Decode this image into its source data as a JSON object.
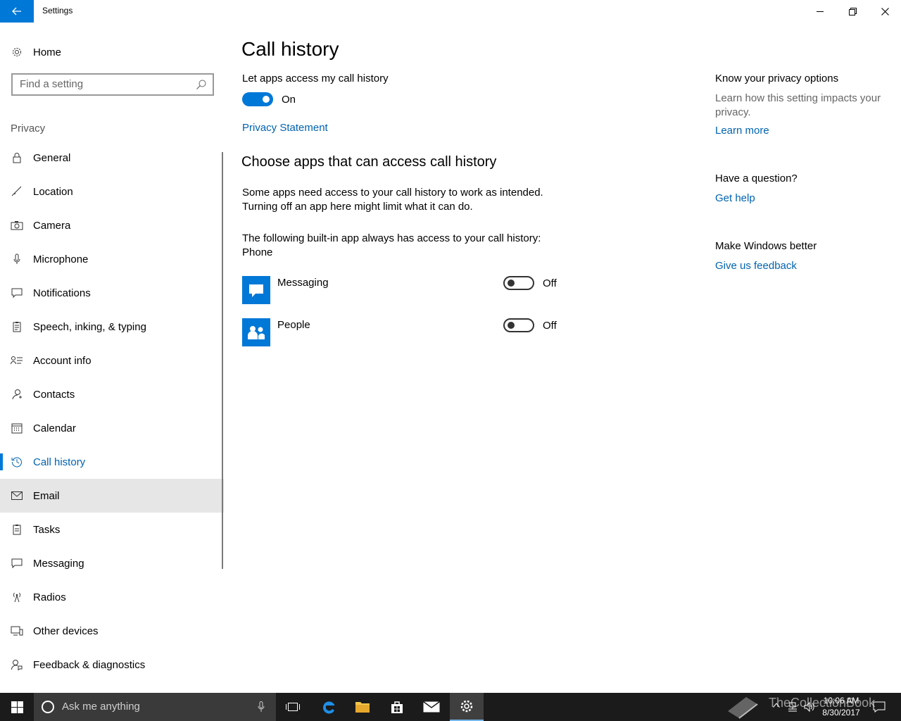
{
  "window": {
    "title": "Settings"
  },
  "sidebar": {
    "home": "Home",
    "search_placeholder": "Find a setting",
    "section": "Privacy",
    "items": [
      {
        "label": "General",
        "icon": "lock-icon"
      },
      {
        "label": "Location",
        "icon": "location-icon"
      },
      {
        "label": "Camera",
        "icon": "camera-icon"
      },
      {
        "label": "Microphone",
        "icon": "microphone-icon"
      },
      {
        "label": "Notifications",
        "icon": "notifications-icon"
      },
      {
        "label": "Speech, inking, & typing",
        "icon": "clipboard-icon"
      },
      {
        "label": "Account info",
        "icon": "account-info-icon"
      },
      {
        "label": "Contacts",
        "icon": "contacts-icon"
      },
      {
        "label": "Calendar",
        "icon": "calendar-icon"
      },
      {
        "label": "Call history",
        "icon": "history-icon"
      },
      {
        "label": "Email",
        "icon": "mail-icon"
      },
      {
        "label": "Tasks",
        "icon": "tasks-icon"
      },
      {
        "label": "Messaging",
        "icon": "message-icon"
      },
      {
        "label": "Radios",
        "icon": "radio-tower-icon"
      },
      {
        "label": "Other devices",
        "icon": "devices-icon"
      },
      {
        "label": "Feedback & diagnostics",
        "icon": "feedback-icon"
      }
    ]
  },
  "main": {
    "title": "Call history",
    "master_label": "Let apps access my call history",
    "master_state": "On",
    "privacy_link": "Privacy Statement",
    "choose_heading": "Choose apps that can access call history",
    "desc_line1": "Some apps need access to your call history to work as intended.",
    "desc_line2": "Turning off an app here might limit what it can do.",
    "builtin_line1": "The following built-in app always has access to your call history:",
    "builtin_line2": "Phone",
    "apps": [
      {
        "name": "Messaging",
        "state": "Off",
        "icon": "messaging-icon"
      },
      {
        "name": "People",
        "state": "Off",
        "icon": "people-icon"
      }
    ]
  },
  "aside": {
    "privacy_heading": "Know your privacy options",
    "privacy_text": "Learn how this setting impacts your privacy.",
    "learn_more": "Learn more",
    "question_heading": "Have a question?",
    "get_help": "Get help",
    "better_heading": "Make Windows better",
    "feedback_link": "Give us feedback"
  },
  "taskbar": {
    "search_placeholder": "Ask me anything",
    "time": "10:06 AM",
    "date": "8/30/2017",
    "watermark": "TheCollectionBook"
  },
  "colors": {
    "accent": "#0078d7",
    "link": "#0063b1",
    "taskbar": "#1b1b1b"
  }
}
